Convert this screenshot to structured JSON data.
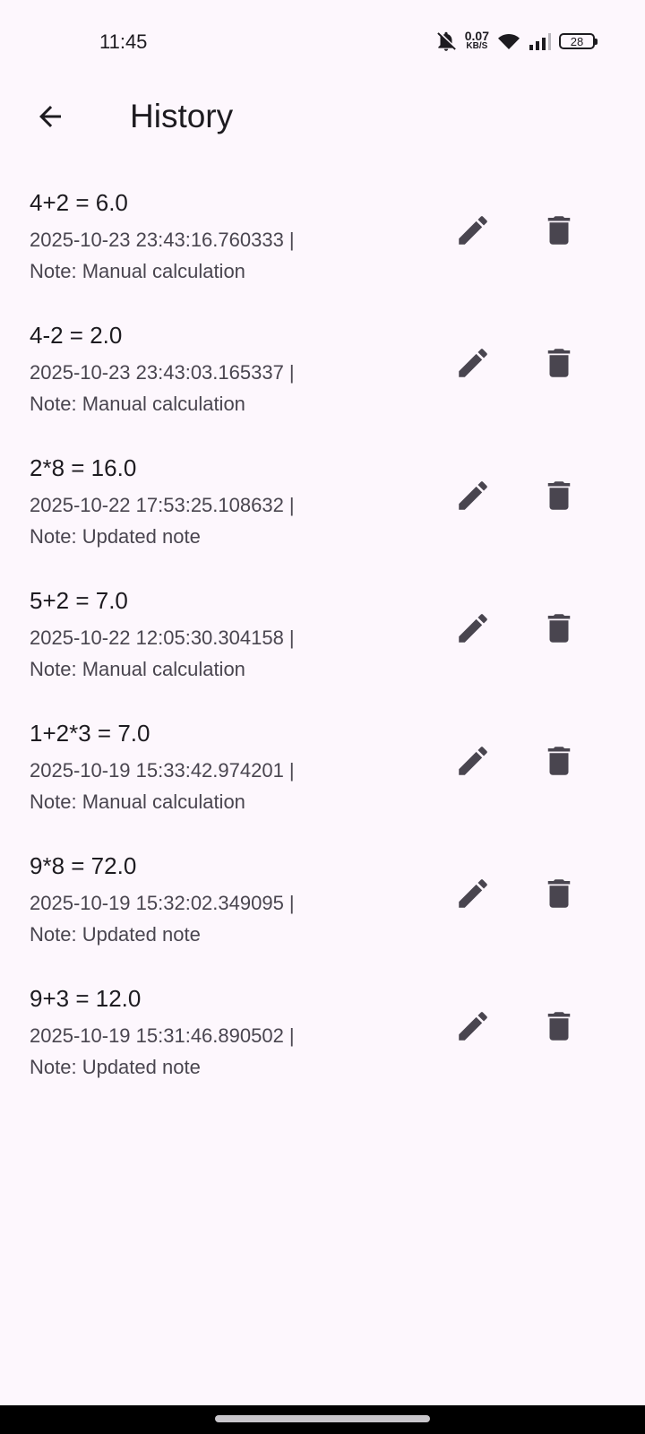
{
  "status_bar": {
    "time": "11:45",
    "net_speed_value": "0.07",
    "net_speed_unit": "KB/S",
    "battery": "28",
    "icons": [
      "bell-off-icon",
      "wifi-icon",
      "signal-icon",
      "battery-icon"
    ]
  },
  "app_bar": {
    "back_icon": "arrow-left-icon",
    "title": "History"
  },
  "history": [
    {
      "expression": "4+2 = 6.0",
      "timestamp": "2025-10-23 23:43:16.760333 |",
      "note": "Note: Manual calculation"
    },
    {
      "expression": "4-2 = 2.0",
      "timestamp": "2025-10-23 23:43:03.165337 |",
      "note": "Note: Manual calculation"
    },
    {
      "expression": "2*8 = 16.0",
      "timestamp": "2025-10-22 17:53:25.108632 |",
      "note": "Note: Updated note"
    },
    {
      "expression": "5+2 = 7.0",
      "timestamp": "2025-10-22 12:05:30.304158 |",
      "note": "Note: Manual calculation"
    },
    {
      "expression": "1+2*3 = 7.0",
      "timestamp": "2025-10-19 15:33:42.974201 |",
      "note": "Note: Manual calculation"
    },
    {
      "expression": "9*8 = 72.0",
      "timestamp": "2025-10-19 15:32:02.349095 |",
      "note": "Note: Updated note"
    },
    {
      "expression": "9+3 = 12.0",
      "timestamp": "2025-10-19 15:31:46.890502 |",
      "note": "Note: Updated note"
    }
  ],
  "item_icons": {
    "edit": "pencil-icon",
    "delete": "trash-icon"
  },
  "colors": {
    "background": "#fdf7fd",
    "text_primary": "#1d1b20",
    "text_secondary": "#49454f",
    "icon": "#49454f"
  }
}
